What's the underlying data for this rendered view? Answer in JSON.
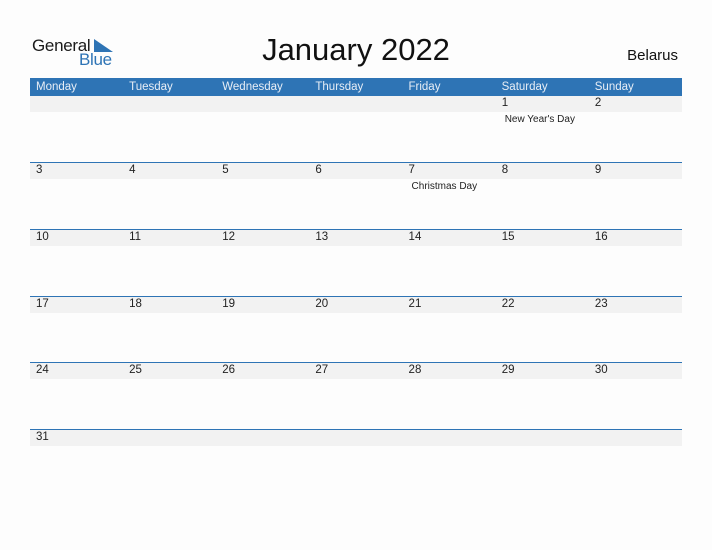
{
  "logo": {
    "line1": "General",
    "line2": "Blue",
    "accent": "#2e74b5"
  },
  "title": "January 2022",
  "country": "Belarus",
  "weekdays": [
    "Monday",
    "Tuesday",
    "Wednesday",
    "Thursday",
    "Friday",
    "Saturday",
    "Sunday"
  ],
  "weeks": [
    [
      {
        "day": ""
      },
      {
        "day": ""
      },
      {
        "day": ""
      },
      {
        "day": ""
      },
      {
        "day": ""
      },
      {
        "day": "1",
        "event": "New Year's Day"
      },
      {
        "day": "2"
      }
    ],
    [
      {
        "day": "3"
      },
      {
        "day": "4"
      },
      {
        "day": "5"
      },
      {
        "day": "6"
      },
      {
        "day": "7",
        "event": "Christmas Day"
      },
      {
        "day": "8"
      },
      {
        "day": "9"
      }
    ],
    [
      {
        "day": "10"
      },
      {
        "day": "11"
      },
      {
        "day": "12"
      },
      {
        "day": "13"
      },
      {
        "day": "14"
      },
      {
        "day": "15"
      },
      {
        "day": "16"
      }
    ],
    [
      {
        "day": "17"
      },
      {
        "day": "18"
      },
      {
        "day": "19"
      },
      {
        "day": "20"
      },
      {
        "day": "21"
      },
      {
        "day": "22"
      },
      {
        "day": "23"
      }
    ],
    [
      {
        "day": "24"
      },
      {
        "day": "25"
      },
      {
        "day": "26"
      },
      {
        "day": "27"
      },
      {
        "day": "28"
      },
      {
        "day": "29"
      },
      {
        "day": "30"
      }
    ],
    [
      {
        "day": "31"
      },
      {
        "day": ""
      },
      {
        "day": ""
      },
      {
        "day": ""
      },
      {
        "day": ""
      },
      {
        "day": ""
      },
      {
        "day": ""
      }
    ]
  ]
}
